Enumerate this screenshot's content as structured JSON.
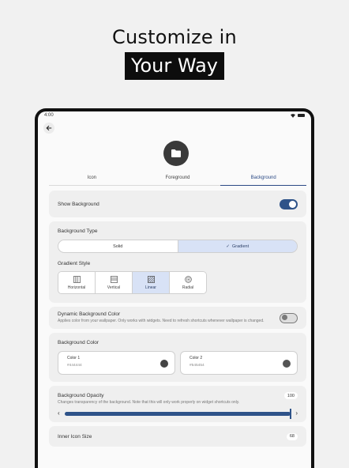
{
  "promo": {
    "line1": "Customize in",
    "line2": "Your Way"
  },
  "status_bar": {
    "time": "4:00"
  },
  "tabs": [
    "Icon",
    "Foreground",
    "Background"
  ],
  "active_tab": "Background",
  "show_background": {
    "label": "Show Background",
    "enabled": true
  },
  "background_type": {
    "label": "Background Type",
    "options": [
      "Solid",
      "Gradient"
    ],
    "selected": "Gradient",
    "check_glyph": "✓"
  },
  "gradient_style": {
    "label": "Gradient Style",
    "options": [
      "Horizontal",
      "Vertical",
      "Linear",
      "Radial"
    ],
    "selected": "Linear"
  },
  "dynamic_background": {
    "label": "Dynamic Background Color",
    "description": "Applies color from your wallpaper. Only works with widgets. Need to refresh shortcuts whenever wallpaper is changed.",
    "enabled": false
  },
  "background_color": {
    "label": "Background Color",
    "color1": {
      "title": "Color 1",
      "value": "#444444",
      "swatch": "#444444"
    },
    "color2": {
      "title": "Color 2",
      "value": "#545454",
      "swatch": "#545454"
    }
  },
  "background_opacity": {
    "label": "Background Opacity",
    "description": "Changes transparency of the background. Note that this will only work properly on widget shortcuts only.",
    "value": "100",
    "fraction": 1.0,
    "prev_glyph": "‹",
    "next_glyph": "›"
  },
  "inner_icon_size": {
    "label": "Inner Icon Size",
    "value": "68"
  },
  "colors": {
    "accent": "#2e5389",
    "selected_fill": "#d8e2f6",
    "card": "#efefef"
  },
  "icons": [
    "back-arrow-icon",
    "folder-icon",
    "wifi-icon",
    "battery-icon",
    "check-icon",
    "horizontal-gradient-icon",
    "vertical-gradient-icon",
    "linear-gradient-icon",
    "radial-gradient-icon",
    "chevron-left-icon",
    "chevron-right-icon"
  ]
}
